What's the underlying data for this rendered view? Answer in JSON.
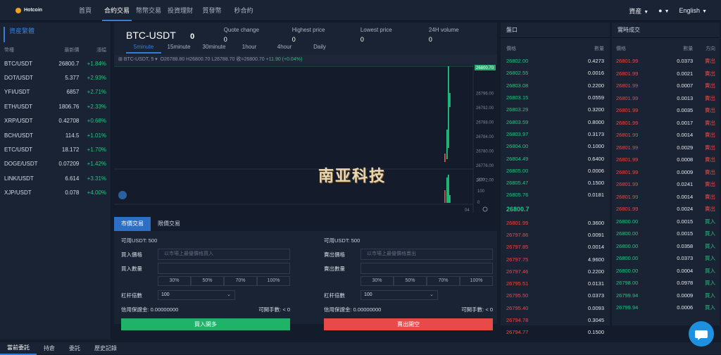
{
  "brand": {
    "name": "Hotcoin"
  },
  "nav": [
    "首頁",
    "合約交易",
    "幣幣交易",
    "投資理財",
    "質發幣",
    "秒合約"
  ],
  "top_right": {
    "assets": "資産",
    "lang": "English"
  },
  "market": {
    "title": "資産繁體",
    "headers": [
      "幣種",
      "最新價",
      "漲幅"
    ],
    "rows": [
      [
        "BTC/USDT",
        "26800.7",
        "+1.84%"
      ],
      [
        "DOT/USDT",
        "5.377",
        "+2.93%"
      ],
      [
        "YFI/USDT",
        "6857",
        "+2.71%"
      ],
      [
        "ETH/USDT",
        "1806.76",
        "+2.33%"
      ],
      [
        "XRP/USDT",
        "0.42708",
        "+0.68%"
      ],
      [
        "BCH/USDT",
        "114.5",
        "+1.01%"
      ],
      [
        "ETC/USDT",
        "18.172",
        "+1.70%"
      ],
      [
        "DOGE/USDT",
        "0.07209",
        "+1.42%"
      ],
      [
        "LINK/USDT",
        "6.614",
        "+3.31%"
      ],
      [
        "XJP/USDT",
        "0.078",
        "+4.00%"
      ]
    ]
  },
  "ticker": {
    "pair": "BTC-USDT",
    "last": "0",
    "stats": [
      {
        "label": "Quote change",
        "value": "0"
      },
      {
        "label": "Highest price",
        "value": "0"
      },
      {
        "label": "Lowest price",
        "value": "0"
      },
      {
        "label": "24H volume",
        "value": "0"
      }
    ],
    "intervals": [
      "5minute",
      "15minute",
      "30minute",
      "1hour",
      "4hour",
      "Daily"
    ]
  },
  "chart_ohlc": {
    "symbol": "BTC-USDT, 5",
    "text": "O26788.80  H26800.70  L26788.70  收=26800.70",
    "change": "+11.90 (+0.04%)"
  },
  "chart_axis": {
    "price_ticks": [
      "26800.70",
      "26796.00",
      "26792.00",
      "26788.00",
      "26784.00",
      "26780.00",
      "26776.00",
      "26772.00"
    ],
    "vol_ticks": [
      "200",
      "100",
      "0"
    ],
    "x_label": "04"
  },
  "watermark": "南亚科技",
  "trade": {
    "tabs": [
      "市價交易",
      "限價交易"
    ],
    "buy": {
      "avail": "可用USDT: 500",
      "price_label": "買入價格",
      "price_ph": "以市場上最優價格買入",
      "qty_label": "買入數量",
      "pcts": [
        "30%",
        "50%",
        "70%",
        "100%"
      ],
      "lev_label": "杠杆倍數",
      "lev": "100",
      "margin": "信用保證金: 0.00000000",
      "max": "可開手數: < 0",
      "btn": "買入開多"
    },
    "sell": {
      "avail": "可用USDT: 500",
      "price_label": "賣出價格",
      "price_ph": "以市場上最優價格賣出",
      "qty_label": "賣出數量",
      "pcts": [
        "30%",
        "50%",
        "70%",
        "100%"
      ],
      "lev_label": "杠杆倍數",
      "lev": "100",
      "margin": "信用保證金: 0.00000000",
      "max": "可開手數: < 0",
      "btn": "賣出開空"
    }
  },
  "orderbook": {
    "title": "盤口",
    "h_price": "價格",
    "h_qty": "數量",
    "bids_top": [
      [
        "26802.00",
        "0.4273"
      ],
      [
        "26802.55",
        "0.0016"
      ],
      [
        "26803.08",
        "0.2200"
      ],
      [
        "26803.15",
        "0.0559"
      ],
      [
        "26803.29",
        "0.3200"
      ],
      [
        "26803.59",
        "0.8000"
      ],
      [
        "26803.97",
        "0.3173"
      ],
      [
        "26804.00",
        "0.1000"
      ],
      [
        "26804.49",
        "0.6400"
      ],
      [
        "26805.00",
        "0.0006"
      ],
      [
        "26805.47",
        "0.1500"
      ],
      [
        "26805.76",
        "0.0181"
      ]
    ],
    "mid": "26800.7",
    "asks": [
      [
        "26801.99",
        "0.3600"
      ],
      [
        "26797.86",
        "0.0091"
      ],
      [
        "26797.85",
        "0.0014"
      ],
      [
        "26797.75",
        "4.9600"
      ],
      [
        "26797.46",
        "0.2200"
      ],
      [
        "26795.51",
        "0.0131"
      ],
      [
        "26795.50",
        "0.0373"
      ],
      [
        "26795.40",
        "0.0093"
      ],
      [
        "26794.78",
        "0.3045"
      ],
      [
        "26794.77",
        "0.1500"
      ]
    ]
  },
  "trades": {
    "title": "實時成交",
    "h_price": "價格",
    "h_qty": "數量",
    "h_dir": "方向",
    "rows": [
      [
        "26801.99",
        "0.0373",
        "賣出"
      ],
      [
        "26801.99",
        "0.0021",
        "賣出"
      ],
      [
        "26801.99",
        "0.0007",
        "賣出"
      ],
      [
        "26801.99",
        "0.0013",
        "賣出"
      ],
      [
        "26801.99",
        "0.0035",
        "賣出"
      ],
      [
        "26801.99",
        "0.0017",
        "賣出"
      ],
      [
        "26801.99",
        "0.0014",
        "賣出"
      ],
      [
        "26801.99",
        "0.0029",
        "賣出"
      ],
      [
        "26801.99",
        "0.0008",
        "賣出"
      ],
      [
        "26801.99",
        "0.0009",
        "賣出"
      ],
      [
        "26801.99",
        "0.0241",
        "賣出"
      ],
      [
        "26801.99",
        "0.0014",
        "賣出"
      ],
      [
        "26801.99",
        "0.0024",
        "賣出"
      ],
      [
        "26800.00",
        "0.0015",
        "買入"
      ],
      [
        "26800.00",
        "0.0015",
        "買入"
      ],
      [
        "26800.00",
        "0.0358",
        "買入"
      ],
      [
        "26800.00",
        "0.0373",
        "買入"
      ],
      [
        "26800.00",
        "0.0004",
        "買入"
      ],
      [
        "26798.00",
        "0.0978",
        "買入"
      ],
      [
        "26799.94",
        "0.0009",
        "買入"
      ],
      [
        "26799.94",
        "0.0006",
        "買入"
      ]
    ]
  },
  "bottom_tabs": [
    "當前委託",
    "持倉",
    "委託",
    "歷史記錄"
  ],
  "colors": {
    "up": "#26c281",
    "down": "#e84a4a",
    "accent": "#3a7bd5"
  }
}
